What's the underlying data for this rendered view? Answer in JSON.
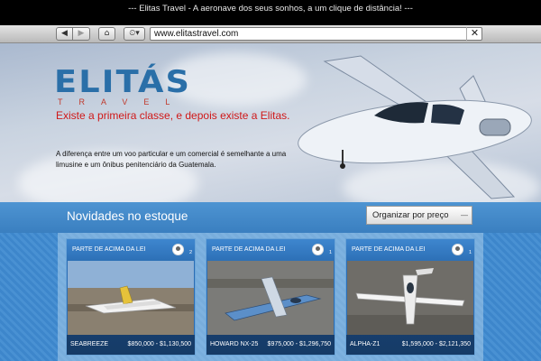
{
  "window": {
    "title": "--- Elitas Travel - A aeronave dos seus sonhos, a um clique de distância! ---"
  },
  "toolbar": {
    "back_glyph": "◀",
    "forward_glyph": "▶",
    "home_glyph": "⌂",
    "history_glyph": "⏲▾",
    "url": "www.elitastravel.com",
    "close_glyph": "✕"
  },
  "hero": {
    "logo_main": "ELITÁS",
    "logo_sub": "TRAVEL",
    "tagline": "Existe a primeira classe, e depois existe a Elitas.",
    "description": "A diferença entre um voo particular e um comercial é semelhante a uma limusine e um ônibus penitenciário da Guatemala."
  },
  "stock": {
    "title": "Novidades no estoque",
    "sort_label": "Organizar por preço",
    "sort_arrow": "—",
    "items": [
      {
        "seller": "PARTE DE ACIMA DA LEI",
        "count": "2",
        "name": "SEABREEZE",
        "price": "$850,000 - $1,130,500"
      },
      {
        "seller": "PARTE DE ACIMA DA LEI",
        "count": "1",
        "name": "HOWARD NX-25",
        "price": "$975,000 - $1,296,750"
      },
      {
        "seller": "PARTE DE ACIMA DA LEI",
        "count": "1",
        "name": "ALPHA-Z1",
        "price": "$1,595,000 - $2,121,350"
      }
    ]
  },
  "colors": {
    "accent": "#2a6fa8",
    "tagline": "#d01818",
    "panel": "#3d86cb"
  }
}
